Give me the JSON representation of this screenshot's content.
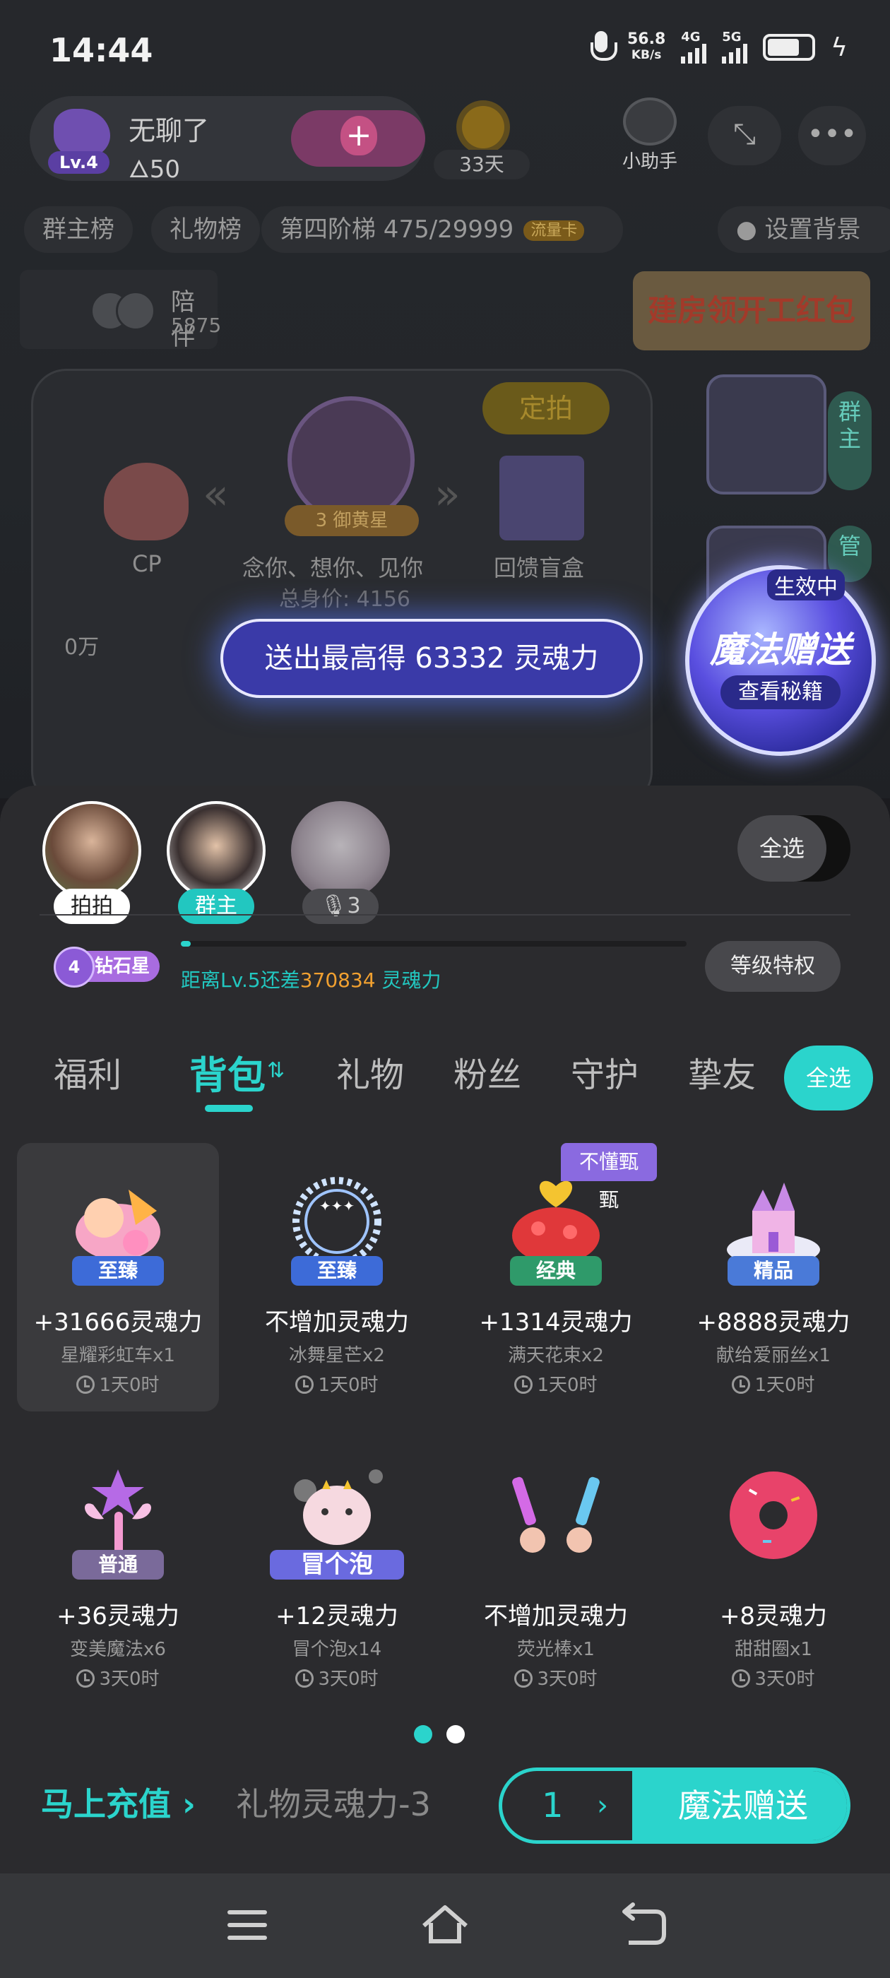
{
  "status": {
    "time": "14:44",
    "speed": "56.8",
    "speed_unit": "KB/s",
    "net1": "4G",
    "net2": "5G"
  },
  "room": {
    "host_name": "无聊了",
    "host_level": "Lv.4",
    "host_count": "50",
    "days": "33天",
    "helper_label": "小助手",
    "chips": [
      "群主榜",
      "礼物榜"
    ],
    "ladder": "第四阶梯 475/29999",
    "flow_card": "流量卡",
    "set_bg": "设置背景",
    "companion_label": "陪伴",
    "companion_value": "5875",
    "redpack": "建房领开工红包",
    "pk_tag": "定拍",
    "cp_label": "CP",
    "center_label": "念你、想你、见你",
    "center_badge": "3 御黄星",
    "total_value": "总身价: 4156",
    "gift_box_label": "回馈盲盒",
    "zero_label": "0万",
    "side_pill_1": "群主",
    "side_pill_2": "管",
    "send_banner": "送出最高得 63332 灵魂力",
    "magic_status": "生效中",
    "magic_title": "魔法赠送",
    "magic_sub": "查看秘籍"
  },
  "sheet": {
    "mic_users": [
      {
        "pill": "拍拍"
      },
      {
        "pill": "群主"
      },
      {
        "pill": "3"
      }
    ],
    "select_all": "全选",
    "level_badge": "钻石星",
    "level_progress": 0.02,
    "level_prefix": "距离Lv.5还差",
    "level_gap": "370834",
    "level_suffix": "灵魂力",
    "level_privilege": "等级特权",
    "tabs": [
      "福利",
      "背包",
      "礼物",
      "粉丝",
      "守护",
      "挚友"
    ],
    "tab_select_all": "全选",
    "gifts": [
      {
        "power": "+31666灵魂力",
        "name": "星耀彩虹车x1",
        "time": "1天0时",
        "tier": "至臻",
        "corner": ""
      },
      {
        "power": "不增加灵魂力",
        "name": "冰舞星芒x2",
        "time": "1天0时",
        "tier": "至臻",
        "corner": ""
      },
      {
        "power": "+1314灵魂力",
        "name": "满天花束x2",
        "time": "1天0时",
        "tier": "经典",
        "corner": "不懂甄甄"
      },
      {
        "power": "+8888灵魂力",
        "name": "献给爱丽丝x1",
        "time": "1天0时",
        "tier": "精品",
        "corner": ""
      },
      {
        "power": "+36灵魂力",
        "name": "变美魔法x6",
        "time": "3天0时",
        "tier": "普通",
        "corner": ""
      },
      {
        "power": "+12灵魂力",
        "name": "冒个泡x14",
        "time": "3天0时",
        "tier": "冒个泡",
        "corner": ""
      },
      {
        "power": "不增加灵魂力",
        "name": "荧光棒x1",
        "time": "3天0时",
        "tier": "",
        "corner": ""
      },
      {
        "power": "+8灵魂力",
        "name": "甜甜圈x1",
        "time": "3天0时",
        "tier": "",
        "corner": ""
      }
    ],
    "recharge": "马上充值",
    "ticker": "礼物灵魂力-3",
    "quantity": "1",
    "send_button": "魔法赠送"
  },
  "colors": {
    "accent": "#2bd4cc",
    "sheet_bg": "#2b2b2e",
    "orange_num": "#f0a030"
  }
}
